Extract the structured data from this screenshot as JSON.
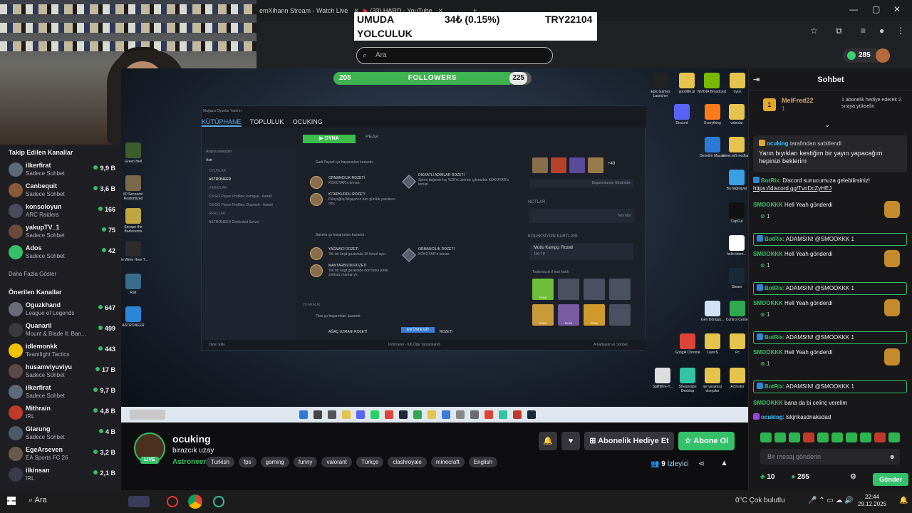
{
  "browser": {
    "tabs": [
      "emXihann Stream - Watch Live",
      "(33) HARD - YouTube"
    ],
    "search_placeholder": "Ara",
    "points": "285"
  },
  "ticker": {
    "name_line1": "UMUDA",
    "name_line2": "YOLCULUK",
    "change": "34₺ (0.15%)",
    "value": "TRY22104"
  },
  "follower_goal": {
    "current": "205",
    "label": "FOLLOWERS",
    "target": "225",
    "progress": 0.91
  },
  "steam": {
    "tabs": [
      "KÜTÜPHANE",
      "TOPLULUK",
      "OCUKING"
    ],
    "top_menu": "Mağaza   Oyunlar   Yardım",
    "play": "OYNA",
    "game": "PEAK",
    "search_label": "Arama sonuçları",
    "search_query": "Astr",
    "left": [
      {
        "t": "OYUNLAR",
        "h": true
      },
      {
        "t": "ASTRONEER",
        "s": true
      },
      {
        "t": "VIDEOLAR",
        "h": true
      },
      {
        "t": "CS:GO Player Profiles: karrigan - Astrali"
      },
      {
        "t": "CS:GO Player Profiles: Dupreeh - Astrali"
      },
      {
        "t": "ARAÇLAR",
        "h": true
      },
      {
        "t": "ASTRONEER Dedicated Server"
      }
    ],
    "feed": {
      "user1": "Sadi Payaslı şu başarımları kazandı:",
      "a1": "ORMANCILIK ROZETİ",
      "a1d": "KÖKOYAR'a teman.",
      "a2": "DİKKATLİ ADIMLAR ROZETİ",
      "a2d": "Sporu değenin hiç %25'in üzerine çıkmadan KÖKOYAR'a teman.",
      "a3": "KİTAPKURDU ROZETİ",
      "a3d": "Dünyağlıq Mişayın'ın tüm günlük yazılarını oku.",
      "user2": "Bavelia şu başarımları kazandı:",
      "b1": "YAĞMACI ROZETİ",
      "b1d": "Tek bir keşif gezisinde 35 bavul açın.",
      "b2": "ORMANCILIK ROZETİ",
      "b2d": "KÖKOYAR'a teman.",
      "b3": "MANTARBİLİM ROZETİ",
      "b3d": "Tek bir keşif gezisinde dört farklı türde zehirsiz mantar ye.",
      "date": "26 ARALIK",
      "user3": "Fliss şu başarımları kazandı:",
      "c1": "AĞAÇ UZMANI ROZETİ",
      "c1b": "EN ÜSTE GİT",
      "c2": "ROZETİ"
    },
    "right": {
      "more": "+49",
      "bar": "Başarımlarımı Görüntüle",
      "notes": "NOTLAR",
      "new_note": "Yeni Not",
      "cards": "KOLEKSİYON KARTLARI",
      "card_name": "Mutlu Kampçı Rozeti",
      "card_xp": "100 TP",
      "card_count": "Toplanacak 8 kart kaldı",
      "peak": "PEAK"
    },
    "status": {
      "add": "Oyun Ekle",
      "dl": "İndirmeler - 6/6 Öğe Tamamlandı",
      "friends": "Arkadaşlar ve Sohbet"
    }
  },
  "desktop_icons": [
    {
      "label": "Epic Games Launcher",
      "color": "#222222"
    },
    {
      "label": "goodlife.pl",
      "color": "#e5c34d"
    },
    {
      "label": "NVIDIA Broadcast",
      "color": "#76b900"
    },
    {
      "label": "oyun",
      "color": "#e5c34d"
    },
    {
      "label": "Discord",
      "color": "#5865f2"
    },
    {
      "label": "Everything",
      "color": "#ff7a1a"
    },
    {
      "label": "videolar",
      "color": "#e5c34d"
    },
    {
      "label": "Denetim Masası",
      "color": "#2b7bd6"
    },
    {
      "label": "minecraft modlar...",
      "color": "#e5c34d"
    },
    {
      "label": "Bu bilgisayar",
      "color": "#3aa0e6"
    },
    {
      "label": "CapCut",
      "color": "#111111"
    },
    {
      "label": "hello there...",
      "color": "#ffffff"
    },
    {
      "label": "Steam",
      "color": "#1b2838"
    },
    {
      "label": "Geri Dönüşü...",
      "color": "#cfe3f4"
    },
    {
      "label": "Control Center",
      "color": "#2fa84f"
    },
    {
      "label": "Google Chrome",
      "color": "#db4437"
    },
    {
      "label": "LazerS",
      "color": "#e5c34d"
    },
    {
      "label": "Pc",
      "color": "#e5c34d"
    },
    {
      "label": "SplitWire-T...",
      "color": "#dddddd"
    },
    {
      "label": "Streamlabs Desktop",
      "color": "#31c3a2"
    },
    {
      "label": "işe yaramaz dosyalar",
      "color": "#e5c34d"
    },
    {
      "label": "Activator",
      "color": "#e5c34d"
    }
  ],
  "left_stream_icons": [
    {
      "label": "Green Hell",
      "color": "#3b5e2a"
    },
    {
      "label": "60 Seconds! Reatomized",
      "color": "#7a6a4a"
    },
    {
      "label": "Escape the Backrooms",
      "color": "#bfa640"
    },
    {
      "label": "We Were Here T...",
      "color": "#2c2c2c"
    },
    {
      "label": "Raft",
      "color": "#3a6b8a"
    },
    {
      "label": "ASTRONEER",
      "color": "#2b86d6"
    }
  ],
  "channel": {
    "name": "ocuking",
    "title": "birazcık uzay",
    "category": "Astroneer",
    "live": "LIVE",
    "tags": [
      "Turkish",
      "fps",
      "gaming",
      "funny",
      "valorant",
      "Türkçe",
      "clashroyale",
      "minecraft",
      "English"
    ],
    "gift_button": "Abonelik Hediye Et",
    "sub_button": "Abone Ol",
    "viewers": "9",
    "viewers_label": "İzleyici"
  },
  "sidebar": {
    "followed_title": "Takip Edilen Kanallar",
    "followed": [
      {
        "name": "ilkerfirat",
        "game": "Sadece Sohbet",
        "viewers": "9,9 B",
        "color": "#5b6b7a"
      },
      {
        "name": "Canbequit",
        "game": "Sadece Sohbet",
        "viewers": "3,6 B",
        "color": "#8a5a3a"
      },
      {
        "name": "konsoloyun",
        "game": "ARC Raiders",
        "viewers": "166",
        "color": "#4a4a5a"
      },
      {
        "name": "yakupTV_1",
        "game": "Sadece Sohbet",
        "viewers": "75",
        "color": "#6a4a3a"
      },
      {
        "name": "Ados",
        "game": "Sadece Sohbet",
        "viewers": "42",
        "color": "#35c06a"
      }
    ],
    "show_more": "Daha Fazla Göster",
    "recommended_title": "Önerilen Kanallar",
    "recommended": [
      {
        "name": "Oguzkhand",
        "game": "League of Legends",
        "viewers": "647",
        "color": "#6a6a7a"
      },
      {
        "name": "Quanaril",
        "game": "Mount & Blade II: Ban...",
        "viewers": "499",
        "color": "#3a3a3a"
      },
      {
        "name": "idlemonkk",
        "game": "Teamfight Tactics",
        "viewers": "443",
        "color": "#f2c200"
      },
      {
        "name": "husamviyuviyu",
        "game": "Sadece Sohbet",
        "viewers": "17 B",
        "color": "#5a4a4a"
      },
      {
        "name": "ilkerfirat",
        "game": "Sadece Sohbet",
        "viewers": "9,7 B",
        "color": "#5b6b7a"
      },
      {
        "name": "Mithrain",
        "game": "IRL",
        "viewers": "4,8 B",
        "color": "#c0392b"
      },
      {
        "name": "Glarung",
        "game": "Sadece Sohbet",
        "viewers": "4 B",
        "color": "#4a5a6a"
      },
      {
        "name": "EgeArseven",
        "game": "EA Sports FC 26",
        "viewers": "3,2 B",
        "color": "#6a5a4a"
      },
      {
        "name": "ilkinsan",
        "game": "IRL",
        "viewers": "2,1 B",
        "color": "#3a3a4a"
      }
    ]
  },
  "chat": {
    "title": "Sohbet",
    "hype_user": "MelFred22",
    "hype_count": "1",
    "hype_msg": "1 abonelik hediye ederek 2. sıraya yükselin",
    "pinned_by": "ocuking",
    "pinned_suffix": "tarafından sabitlendi",
    "pinned_text": "Yarın bıyıkları kestiğim bir yayın yapacağım hepinizi beklerim",
    "discord_user": "BotRix",
    "discord_text": "Discord sunucumuza gelebilirsiniz!",
    "discord_link": "https://discord.gg/TvnDcZyHEJ",
    "messages": [
      {
        "user": "SMOOKKK",
        "text": "Hell Yeah gönderdi",
        "sub": "1"
      },
      {
        "user": "BotRix",
        "text": "ADAMSIN! @SMOOKKK 1",
        "bot": true
      },
      {
        "user": "SMOOKKK",
        "text": "Hell Yeah gönderdi",
        "sub": "1"
      },
      {
        "user": "BotRix",
        "text": "ADAMSIN! @SMOOKKK 1",
        "bot": true
      },
      {
        "user": "SMOOKKK",
        "text": "Hell Yeah gönderdi",
        "sub": "1"
      },
      {
        "user": "BotRix",
        "text": "ADAMSIN! @SMOOKKK 1",
        "bot": true
      },
      {
        "user": "SMOOKKK",
        "text": "Hell Yeah gönderdi",
        "sub": "1"
      },
      {
        "user": "BotRix",
        "text": "ADAMSIN! @SMOOKKK 1",
        "bot": true
      }
    ],
    "smookkk_msg": "bana da bi celinç verelim",
    "ocuking_msg": "lskjnkasdnaksdad",
    "input_placeholder": "Bir mesaj gönderin",
    "footer_left": "10",
    "footer_points": "285",
    "send": "Gönder"
  },
  "taskbar": {
    "search": "Ara",
    "weather": "0°C  Çok bulutlu",
    "time": "22:44",
    "date": "29.12.2025"
  }
}
